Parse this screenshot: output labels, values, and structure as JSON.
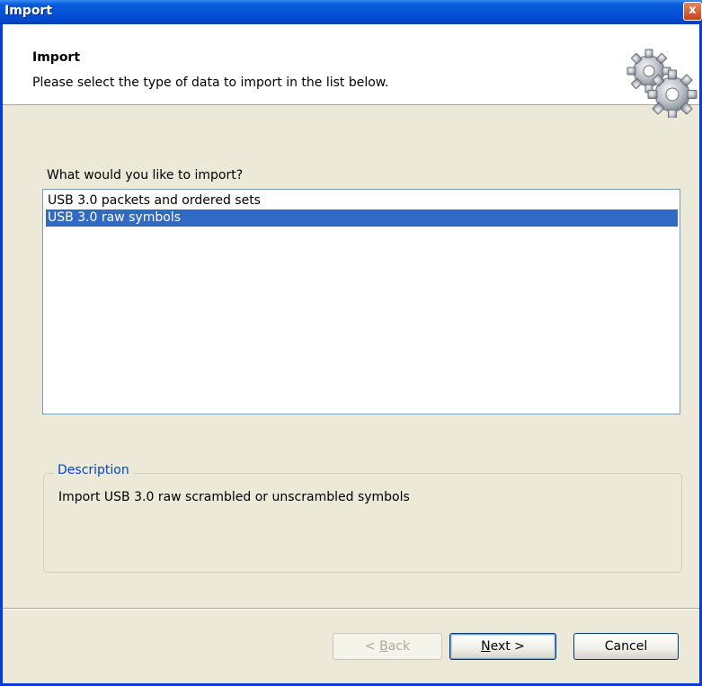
{
  "window": {
    "title": "Import",
    "close_glyph": "x"
  },
  "header": {
    "title": "Import",
    "subtitle": "Please select the type of data to import in the list below.",
    "icon": "gears-icon"
  },
  "prompt": "What would you like to import?",
  "list": {
    "items": [
      {
        "label": "USB 3.0 packets and ordered sets",
        "selected": false
      },
      {
        "label": "USB 3.0 raw symbols",
        "selected": true
      }
    ]
  },
  "description": {
    "legend": "Description",
    "text": "Import USB 3.0 raw scrambled or unscrambled symbols"
  },
  "buttons": {
    "back": {
      "prefix": "< ",
      "mnemonic": "B",
      "rest": "ack",
      "enabled": false
    },
    "next": {
      "mnemonic": "N",
      "rest": "ext >",
      "enabled": true
    },
    "cancel": {
      "label": "Cancel",
      "enabled": true
    }
  },
  "colors": {
    "titlebar": "#0552D8",
    "selection": "#316AC5",
    "legend": "#0046D5",
    "dialog_bg": "#ECE9D8"
  }
}
